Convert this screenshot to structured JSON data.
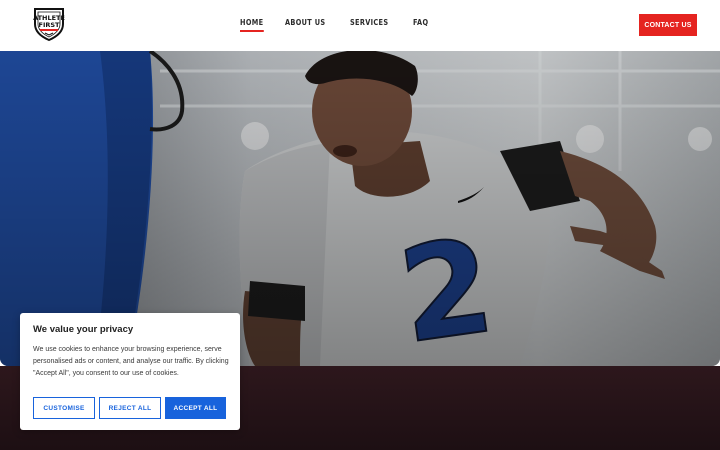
{
  "header": {
    "logo_alt": "ATHLETE FIRST",
    "logo_text_line1": "ATHLETE",
    "logo_text_line2": "FIRST",
    "nav": [
      {
        "label": "HOME",
        "active": true
      },
      {
        "label": "ABOUT US",
        "active": false
      },
      {
        "label": "SERVICES",
        "active": false
      },
      {
        "label": "FAQ",
        "active": false
      }
    ],
    "contact_label": "CONTACT US"
  },
  "hero": {
    "jersey_number": "2"
  },
  "cookie": {
    "title": "We value your privacy",
    "body": "We use cookies to enhance your browsing experience, serve personalised ads or content, and analyse our traffic. By clicking \"Accept All\", you consent to our use of cookies.",
    "customise_label": "CUSTOMISE",
    "reject_label": "REJECT ALL",
    "accept_label": "ACCEPT ALL"
  },
  "colors": {
    "accent_red": "#e52420",
    "cookie_blue": "#1863dc",
    "dark_band": "#2a161b"
  }
}
